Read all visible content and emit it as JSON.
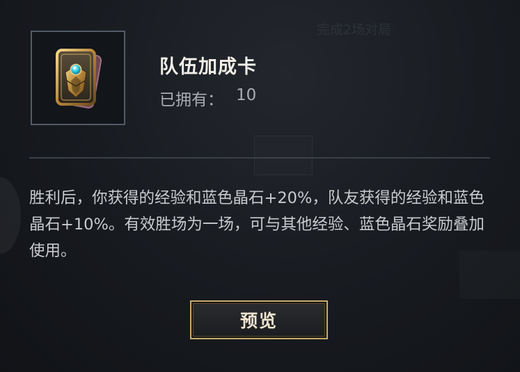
{
  "background": {
    "ghost_task_text": "完成2场对局"
  },
  "item": {
    "icon": "team-boost-card-icon",
    "title": "队伍加成卡",
    "owned_label": "已拥有：",
    "owned_count": "10"
  },
  "description": "胜利后，你获得的经验和蓝色晶石+20%，队友获得的经验和蓝色晶石+10%。有效胜场为一场，可与其他经验、蓝色晶石奖励叠加使用。",
  "actions": {
    "preview_label": "预览"
  },
  "colors": {
    "background": "#171a1f",
    "accent_gold": "#c8aa6e",
    "title_text": "#f1efe8",
    "body_text": "#c9cbce",
    "gem_blue": "#2fd3e6"
  }
}
